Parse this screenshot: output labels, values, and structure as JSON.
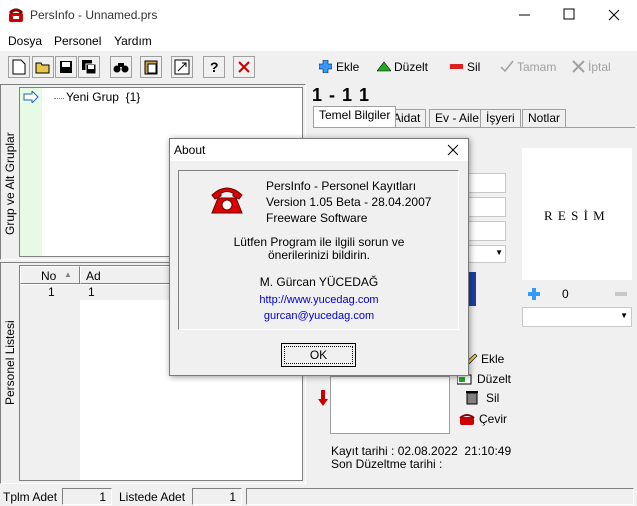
{
  "window": {
    "title": "PersInfo - Unnamed.prs"
  },
  "menu": [
    "Dosya",
    "Personel",
    "Yardım"
  ],
  "toolbar_right": {
    "add": "Ekle",
    "edit": "Düzelt",
    "delete": "Sil",
    "ok": "Tamam",
    "cancel": "İptal"
  },
  "groups_panel": {
    "label": "Grup ve Alt Gruplar",
    "tree_item": "Yeni Grup  {1}"
  },
  "personnel_panel": {
    "label": "Personel Listesi",
    "columns": [
      "No",
      "Ad"
    ],
    "rows": [
      {
        "no": "1",
        "ad": "1"
      }
    ]
  },
  "record": {
    "header": "1 - 1 1",
    "tabs": [
      "Temel Bilgiler",
      "Aidat",
      "Ev - Aile",
      "İşyeri",
      "Notlar"
    ],
    "photo_label": "R E S İ M",
    "counter": "0",
    "family_buttons": {
      "add": "Ekle",
      "edit": "Düzelt",
      "delete": "Sil",
      "turn": "Çevir"
    },
    "created": "Kayıt tarihi : 02.08.2022  21:10:49",
    "modified": "Son Düzeltme tarihi :"
  },
  "status": {
    "total_label": "Tplm Adet",
    "total_value": "1",
    "list_label": "Listede Adet",
    "list_value": "1"
  },
  "about": {
    "title": "About",
    "app": "PersInfo - Personel Kayıtları",
    "version": "Version 1.05 Beta - 28.04.2007",
    "license": "Freeware Software",
    "msg1": "Lütfen Program ile ilgili sorun ve",
    "msg2": "önerilerinizi bildirin.",
    "author": "M. Gürcan YÜCEDAĞ",
    "url": "http://www.yucedag.com",
    "email": "gurcan@yucedag.com",
    "ok": "OK"
  },
  "colors": {
    "link": "#0000cc",
    "tree_bg": "#e6fbe6",
    "accent_red": "#cc0000"
  }
}
